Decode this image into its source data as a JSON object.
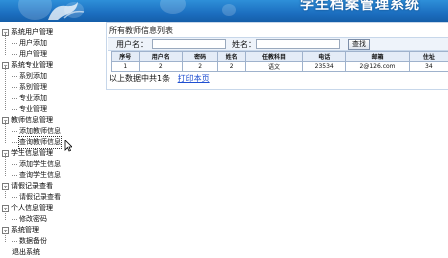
{
  "header": {
    "system_title": "学生档案管理系统"
  },
  "sidebar": {
    "groups": [
      {
        "label": "系统用户管理",
        "items": [
          "用户添加",
          "用户管理"
        ]
      },
      {
        "label": "系统专业管理",
        "items": [
          "系别添加",
          "系别管理",
          "专业添加",
          "专业管理"
        ]
      },
      {
        "label": "教师信息管理",
        "items": [
          "添加教师信息",
          "查询教师信息"
        ]
      },
      {
        "label": "学生信息管理",
        "items": [
          "添加学生信息",
          "查询学生信息"
        ]
      },
      {
        "label": "请假记录查看",
        "items": [
          "请假记录查看"
        ]
      },
      {
        "label": "个人信息管理",
        "items": [
          "修改密码"
        ]
      },
      {
        "label": "系统管理",
        "items": [
          "数据备份"
        ]
      }
    ],
    "partial_next_label": "退出系统",
    "active_item": "查询教师信息"
  },
  "main": {
    "panel_title": "所有教师信息列表",
    "search": {
      "username_label": "用户名：",
      "name_label": "姓名：",
      "username_value": "",
      "name_value": "",
      "button_label": "查找"
    },
    "table": {
      "headers": [
        "序号",
        "用户名",
        "密码",
        "姓名",
        "任教科目",
        "电话",
        "邮箱",
        "住址"
      ],
      "rows": [
        [
          "1",
          "2",
          "2",
          "2",
          "语文",
          "23534",
          "2@126.com",
          "34"
        ]
      ]
    },
    "footer_text": "以上数据中共1条",
    "print_link": "打印本页"
  }
}
